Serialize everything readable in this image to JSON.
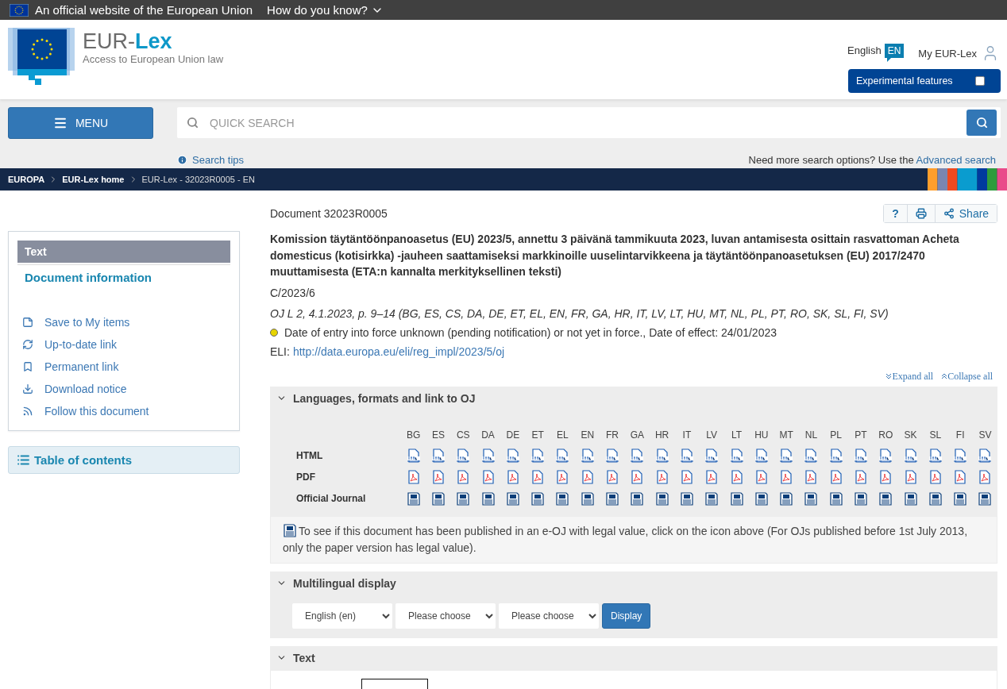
{
  "topbar": {
    "text": "An official website of the European Union",
    "link": "How do you know?"
  },
  "header": {
    "logo_name": "EUR-",
    "logo_bold": "Lex",
    "tagline": "Access to European Union law",
    "language": "English",
    "language_code": "EN",
    "account": "My EUR-Lex",
    "experimental": {
      "label": "Experimental features",
      "checked": false
    }
  },
  "search": {
    "menu": "MENU",
    "placeholder": "QUICK SEARCH",
    "tips": "Search tips",
    "more": "Need more search options? Use the",
    "advanced": "Advanced search"
  },
  "breadcrumb": [
    {
      "label": "EUROPA",
      "current": false
    },
    {
      "label": "EUR-Lex home",
      "current": false
    },
    {
      "label": "EUR-Lex - 32023R0005 - EN",
      "current": true
    }
  ],
  "sidebar": {
    "tabs": [
      {
        "label": "Text",
        "selected": true
      },
      {
        "label": "Document information",
        "selected": false
      }
    ],
    "actions": [
      {
        "label": "Save to My items"
      },
      {
        "label": "Up-to-date link"
      },
      {
        "label": "Permanent link"
      },
      {
        "label": "Download notice"
      },
      {
        "label": "Follow this document"
      }
    ],
    "toc": "Table of contents"
  },
  "document": {
    "id": "Document 32023R0005",
    "help": "?",
    "share": "Share",
    "title": "Komission täytäntöönpanoasetus (EU) 2023/5, annettu 3 päivänä tammikuuta 2023, luvan antamisesta osittain rasvattoman Acheta domesticus (kotisirkka) -jauheen saattamiseksi markkinoille uuselintarvikkeena ja täytäntöönpanoasetuksen (EU) 2017/2470 muuttamisesta (ETA:n kannalta merkityksellinen teksti)",
    "reference": "C/2023/6",
    "oj": "OJ L 2, 4.1.2023, p. 9–14 (BG, ES, CS, DA, DE, ET, EL, EN, FR, GA, HR, IT, LV, LT, HU, MT, NL, PL, PT, RO, SK, SL, FI, SV)",
    "status": {
      "color": "#e6d400",
      "text": "Date of entry into force unknown (pending notification) or not yet in force., Date of effect: 24/01/2023"
    },
    "eli_label": "ELI:",
    "eli_link": "http://data.europa.eu/eli/reg_impl/2023/5/oj",
    "expand": "Expand all",
    "collapse": "Collapse all"
  },
  "sections": [
    {
      "kind": "formats",
      "title": "Languages, formats and link to OJ",
      "expanded": true,
      "languages": [
        "BG",
        "ES",
        "CS",
        "DA",
        "DE",
        "ET",
        "EL",
        "EN",
        "FR",
        "GA",
        "HR",
        "IT",
        "LV",
        "LT",
        "HU",
        "MT",
        "NL",
        "PL",
        "PT",
        "RO",
        "SK",
        "SL",
        "FI",
        "SV"
      ],
      "rows": [
        {
          "kind": "html",
          "label": "HTML"
        },
        {
          "kind": "pdf",
          "label": "PDF"
        },
        {
          "kind": "oj",
          "label": "Official Journal"
        }
      ],
      "note": "To see if this document has been published in an e-OJ with legal value, click on the icon above (For OJs published before 1st July 2013, only the paper version has legal value)."
    },
    {
      "kind": "multilingual",
      "title": "Multilingual display",
      "expanded": true,
      "selects": [
        "English (en)",
        "Please choose",
        "Please choose"
      ],
      "button": "Display"
    },
    {
      "kind": "text",
      "title": "Text",
      "expanded": true
    }
  ]
}
